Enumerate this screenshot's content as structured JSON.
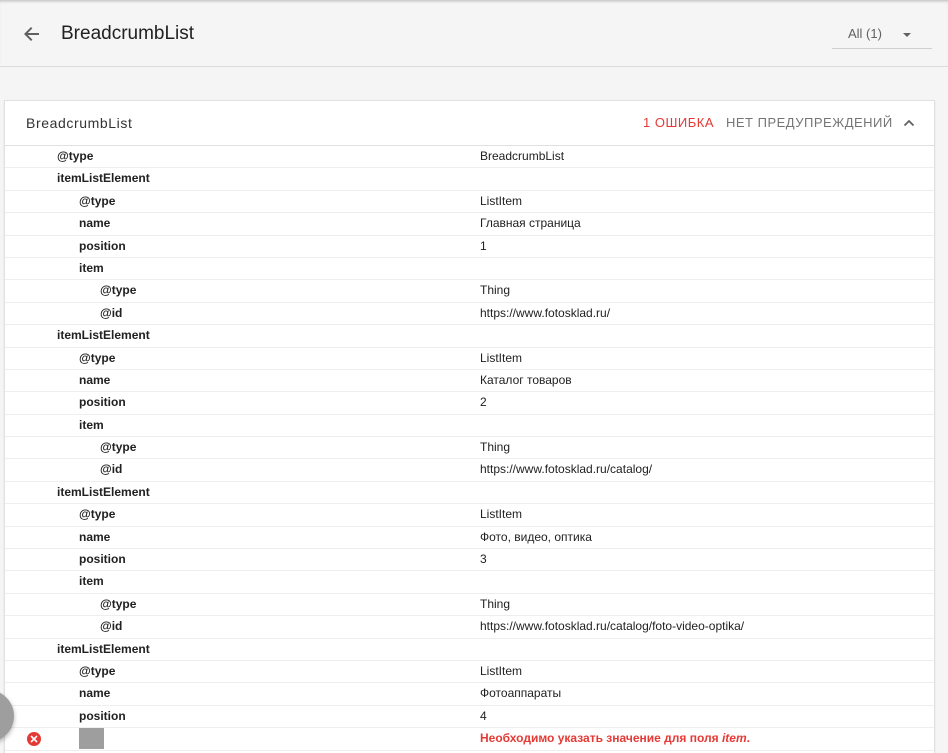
{
  "header": {
    "title": "BreadcrumbList",
    "filter_value": "All (1)"
  },
  "card": {
    "title": "BreadcrumbList",
    "errors_label": "1 ОШИБКА",
    "warnings_label": "НЕТ ПРЕДУПРЕЖДЕНИЙ"
  },
  "rows": [
    {
      "key": "@type",
      "value": "BreadcrumbList"
    },
    {
      "key": "itemListElement",
      "value": ""
    },
    {
      "key": "@type",
      "value": "ListItem"
    },
    {
      "key": "name",
      "value": "Главная страница"
    },
    {
      "key": "position",
      "value": "1"
    },
    {
      "key": "item",
      "value": ""
    },
    {
      "key": "@type",
      "value": "Thing"
    },
    {
      "key": "@id",
      "value": "https://www.fotosklad.ru/"
    },
    {
      "key": "itemListElement",
      "value": ""
    },
    {
      "key": "@type",
      "value": "ListItem"
    },
    {
      "key": "name",
      "value": "Каталог товаров"
    },
    {
      "key": "position",
      "value": "2"
    },
    {
      "key": "item",
      "value": ""
    },
    {
      "key": "@type",
      "value": "Thing"
    },
    {
      "key": "@id",
      "value": "https://www.fotosklad.ru/catalog/"
    },
    {
      "key": "itemListElement",
      "value": ""
    },
    {
      "key": "@type",
      "value": "ListItem"
    },
    {
      "key": "name",
      "value": "Фото, видео, оптика"
    },
    {
      "key": "position",
      "value": "3"
    },
    {
      "key": "item",
      "value": ""
    },
    {
      "key": "@type",
      "value": "Thing"
    },
    {
      "key": "@id",
      "value": "https://www.fotosklad.ru/catalog/foto-video-optika/"
    },
    {
      "key": "itemListElement",
      "value": ""
    },
    {
      "key": "@type",
      "value": "ListItem"
    },
    {
      "key": "name",
      "value": "Фотоаппараты"
    },
    {
      "key": "position",
      "value": "4"
    }
  ],
  "error_row": {
    "key": "item",
    "message_prefix": "Необходимо указать значение для поля ",
    "message_field": "item",
    "message_suffix": "."
  },
  "colors": {
    "error": "#e53935",
    "muted": "#757575"
  },
  "icons": {
    "back": "arrow-back-icon",
    "dropdown": "caret-down-icon",
    "collapse": "chevron-up-icon",
    "error": "error-circle-icon"
  }
}
